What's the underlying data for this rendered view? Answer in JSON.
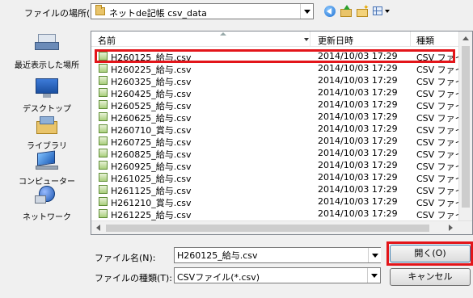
{
  "toolbar": {
    "lookin_label": "ファイルの場所(I):",
    "lookin_value": "ネットde記帳 csv_data"
  },
  "places": [
    {
      "label": "最近表示した場所",
      "icon": "recent-places-icon"
    },
    {
      "label": "デスクトップ",
      "icon": "desktop-icon"
    },
    {
      "label": "ライブラリ",
      "icon": "libraries-icon"
    },
    {
      "label": "コンピューター",
      "icon": "computer-icon"
    },
    {
      "label": "ネットワーク",
      "icon": "network-icon"
    }
  ],
  "columns": {
    "name": "名前",
    "date": "更新日時",
    "type": "種類"
  },
  "files": [
    {
      "name": "H260125_給与.csv",
      "date": "2014/10/03 17:29",
      "type": "CSV ファイル"
    },
    {
      "name": "H260225_給与.csv",
      "date": "2014/10/03 17:29",
      "type": "CSV ファイル"
    },
    {
      "name": "H260325_給与.csv",
      "date": "2014/10/03 17:29",
      "type": "CSV ファイル"
    },
    {
      "name": "H260425_給与.csv",
      "date": "2014/10/03 17:29",
      "type": "CSV ファイル"
    },
    {
      "name": "H260525_給与.csv",
      "date": "2014/10/03 17:29",
      "type": "CSV ファイル"
    },
    {
      "name": "H260625_給与.csv",
      "date": "2014/10/03 17:29",
      "type": "CSV ファイル"
    },
    {
      "name": "H260710_賞与.csv",
      "date": "2014/10/03 17:29",
      "type": "CSV ファイル"
    },
    {
      "name": "H260725_給与.csv",
      "date": "2014/10/03 17:29",
      "type": "CSV ファイル"
    },
    {
      "name": "H260825_給与.csv",
      "date": "2014/10/03 17:29",
      "type": "CSV ファイル"
    },
    {
      "name": "H260925_給与.csv",
      "date": "2014/10/03 17:29",
      "type": "CSV ファイル"
    },
    {
      "name": "H261025_給与.csv",
      "date": "2014/10/03 17:29",
      "type": "CSV ファイル"
    },
    {
      "name": "H261125_給与.csv",
      "date": "2014/10/03 17:29",
      "type": "CSV ファイル"
    },
    {
      "name": "H261210_賞与.csv",
      "date": "2014/10/03 17:29",
      "type": "CSV ファイル"
    },
    {
      "name": "H261225_給与.csv",
      "date": "2014/10/03 17:29",
      "type": "CSV ファイル"
    }
  ],
  "bottom": {
    "filename_label": "ファイル名(N):",
    "filename_value": "H260125_給与.csv",
    "filetype_label": "ファイルの種類(T):",
    "filetype_value": "CSVファイル(*.csv)",
    "open_label": "開く(O)",
    "cancel_label": "キャンセル"
  },
  "colors": {
    "highlight": "#e3151a"
  }
}
